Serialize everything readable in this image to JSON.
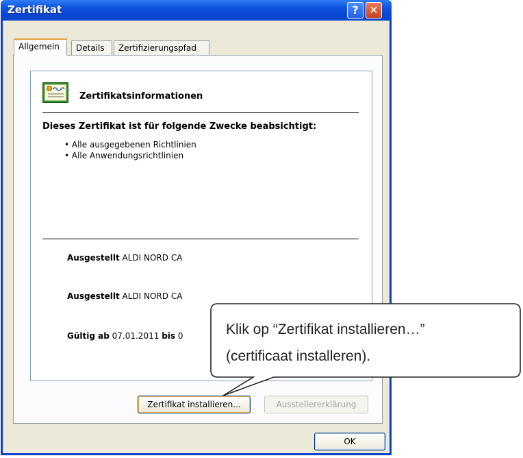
{
  "window": {
    "title": "Zertifikat",
    "help_glyph": "?",
    "close_glyph": "✕"
  },
  "tabs": [
    {
      "label": "Allgemein",
      "active": true
    },
    {
      "label": "Details",
      "active": false
    },
    {
      "label": "Zertifizierungspfad",
      "active": false
    }
  ],
  "info": {
    "heading": "Zertifikatsinformationen",
    "purposes_title": "Dieses Zertifikat ist für folgende Zwecke beabsichtigt:",
    "purposes": [
      "• Alle ausgegebenen Richtlinien",
      "• Alle Anwendungsrichtlinien"
    ],
    "issued_to_label": "Ausgestellt",
    "issued_to_value": "ALDI NORD CA",
    "issued_by_label": "Ausgestellt",
    "issued_by_value": "ALDI NORD CA",
    "valid_from_label": "Gültig ab",
    "valid_from_value": "07.01.2011",
    "valid_to_label": "bis",
    "valid_to_value": "0"
  },
  "buttons": {
    "install": "Zertifikat installieren...",
    "issuer_statement": "Ausstellererklärung",
    "ok": "OK"
  },
  "callout": {
    "line1": "Klik op “Zertifikat installieren…”",
    "line2": "(certificaat installeren)."
  },
  "icons": [
    "certificate-icon",
    "help-icon",
    "close-icon"
  ],
  "colors": {
    "titlebar": "#0a45d4",
    "dialog_bg": "#ece9d8",
    "active_tab_accent": "#e8a037"
  }
}
